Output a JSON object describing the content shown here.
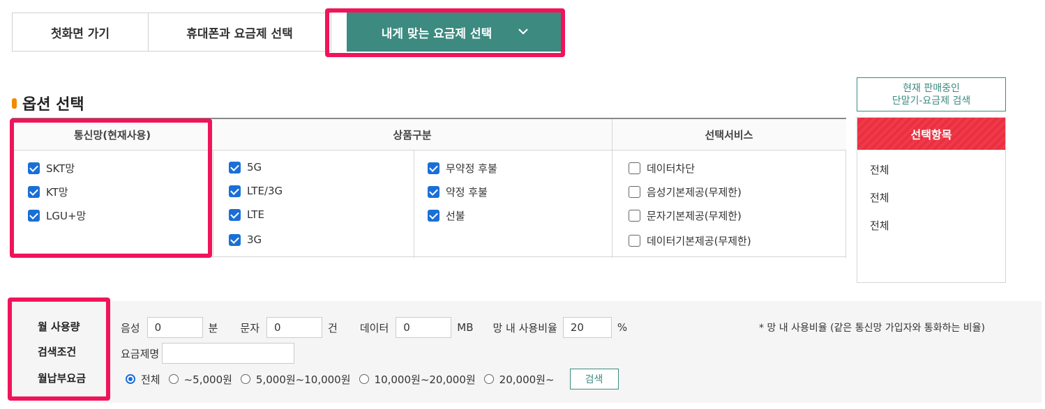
{
  "tabs": {
    "home": "첫화면 가기",
    "phone_plan": "휴대폰과 요금제 선택",
    "my_plan": "내게 맞는 요금제 선택"
  },
  "section_title": "옵션 선택",
  "network": {
    "header": "통신망(현재사용)",
    "items": [
      {
        "label": "SKT망",
        "checked": true
      },
      {
        "label": "KT망",
        "checked": true
      },
      {
        "label": "LGU+망",
        "checked": true
      }
    ]
  },
  "product": {
    "header": "상품구분",
    "col1": [
      {
        "label": "5G",
        "checked": true
      },
      {
        "label": "LTE/3G",
        "checked": true
      },
      {
        "label": "LTE",
        "checked": true
      },
      {
        "label": "3G",
        "checked": true
      }
    ],
    "col2": [
      {
        "label": "무약정 후불",
        "checked": true
      },
      {
        "label": "약정 후불",
        "checked": true
      },
      {
        "label": "선불",
        "checked": true
      }
    ]
  },
  "service": {
    "header": "선택서비스",
    "items": [
      {
        "label": "데이터차단",
        "checked": false
      },
      {
        "label": "음성기본제공(무제한)",
        "checked": false
      },
      {
        "label": "문자기본제공(무제한)",
        "checked": false
      },
      {
        "label": "데이터기본제공(무제한)",
        "checked": false
      }
    ]
  },
  "right_panel": {
    "search_button_line1": "현재 판매중인",
    "search_button_line2": "단말기-요금제 검색",
    "selected_header": "선택항목",
    "selected_items": [
      "전체",
      "전체",
      "전체"
    ]
  },
  "search": {
    "label_usage": "월 사용량",
    "label_condition": "검색조건",
    "label_fee": "월납부요금",
    "voice_label": "음성",
    "voice_value": "0",
    "voice_unit": "분",
    "sms_label": "문자",
    "sms_value": "0",
    "sms_unit": "건",
    "data_label": "데이터",
    "data_value": "0",
    "data_unit": "MB",
    "ratio_label": "망 내 사용비율",
    "ratio_value": "20",
    "ratio_unit": "%",
    "ratio_note": "* 망 내 사용비율 (같은 통신망 가입자와 통화하는 비율)",
    "plan_name_label": "요금제명",
    "plan_name_value": "",
    "fee_options": [
      {
        "label": "전체",
        "selected": true
      },
      {
        "label": "~5,000원",
        "selected": false
      },
      {
        "label": "5,000원~10,000원",
        "selected": false
      },
      {
        "label": "10,000원~20,000원",
        "selected": false
      },
      {
        "label": "20,000원~",
        "selected": false
      }
    ],
    "search_button": "검색"
  },
  "colors": {
    "accent_teal": "#3c8a80",
    "highlight_pink": "#f0145a",
    "checkbox_blue": "#1a6fd6",
    "panel_red": "#f0394a"
  }
}
